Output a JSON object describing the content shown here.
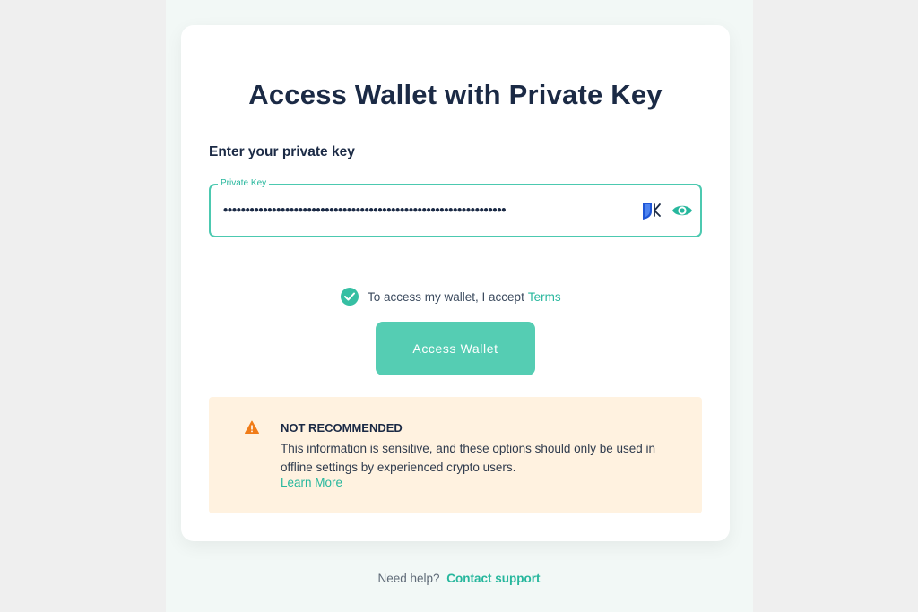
{
  "page": {
    "title": "Access Wallet with Private Key",
    "subheading": "Enter your private key"
  },
  "private_key_field": {
    "label": "Private Key",
    "value": "••••••••••••••••••••••••••••••••••••••••••••••••••••••••••••••••",
    "icons": [
      "keybase-icon",
      "eye-icon"
    ]
  },
  "terms": {
    "checked": true,
    "text": "To access my wallet, I accept",
    "link": "Terms"
  },
  "access_button": {
    "label": "Access Wallet"
  },
  "warning": {
    "title": "NOT RECOMMENDED",
    "text": "This information is sensitive, and these options should only be used in offline settings by experienced crypto users.",
    "link": "Learn More",
    "icon": "warning-icon"
  },
  "help": {
    "text": "Need help?",
    "link": "Contact support"
  },
  "colors": {
    "accent": "#27b79d",
    "button": "#55cdb3",
    "warning_bg": "#fff2e0",
    "title": "#1b2a45"
  }
}
